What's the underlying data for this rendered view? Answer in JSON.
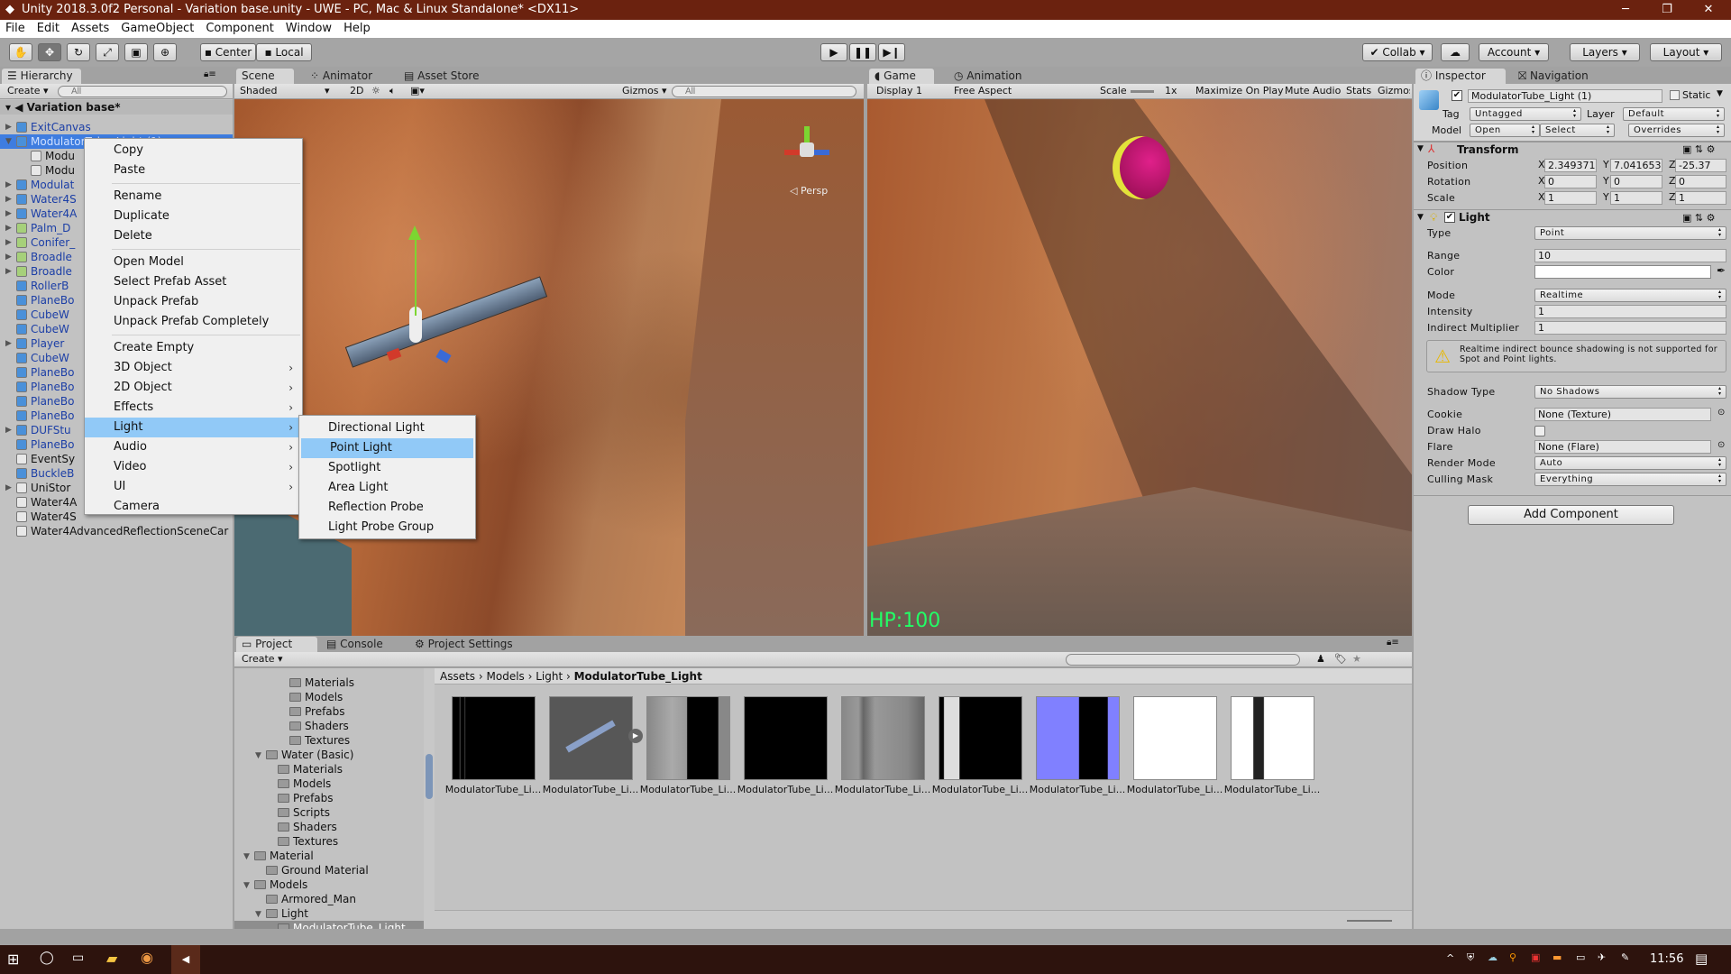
{
  "window": {
    "title": "Unity 2018.3.0f2 Personal - Variation base.unity - UWE - PC, Mac & Linux Standalone* <DX11>",
    "minimize": "─",
    "maximize": "❐",
    "close": "✕"
  },
  "menu": [
    "File",
    "Edit",
    "Assets",
    "GameObject",
    "Component",
    "Window",
    "Help"
  ],
  "toolbar": {
    "center": "Center",
    "local": "Local",
    "collab": "Collab ▾",
    "account": "Account",
    "layers": "Layers",
    "layout": "Layout",
    "tools": [
      "hand-tool",
      "move-tool",
      "rotate-tool",
      "scale-tool",
      "rect-tool",
      "transform-tool"
    ]
  },
  "hierarchy": {
    "tab": "Hierarchy",
    "create": "Create",
    "search_placeholder": "All",
    "scene": "Variation base*",
    "items": [
      {
        "label": "ExitCanvas",
        "kind": "prefab",
        "arrow": "right",
        "depth": 0
      },
      {
        "label": "ModulatorTube_Light (1)",
        "kind": "prefab",
        "arrow": "down",
        "depth": 0,
        "selected": true
      },
      {
        "label": "Modu",
        "kind": "object",
        "depth": 1
      },
      {
        "label": "Modu",
        "kind": "object",
        "depth": 1
      },
      {
        "label": "Modulat",
        "kind": "prefab",
        "arrow": "right",
        "depth": 0
      },
      {
        "label": "Water4S",
        "kind": "prefab",
        "arrow": "right",
        "depth": 0
      },
      {
        "label": "Water4A",
        "kind": "prefab",
        "arrow": "right",
        "depth": 0
      },
      {
        "label": "Palm_D",
        "kind": "tree",
        "arrow": "right",
        "depth": 0
      },
      {
        "label": "Conifer_",
        "kind": "tree",
        "arrow": "right",
        "depth": 0
      },
      {
        "label": "Broadle",
        "kind": "tree",
        "arrow": "right",
        "depth": 0
      },
      {
        "label": "Broadle",
        "kind": "tree",
        "arrow": "right",
        "depth": 0
      },
      {
        "label": "RollerB",
        "kind": "prefab",
        "depth": 0
      },
      {
        "label": "PlaneBo",
        "kind": "prefab",
        "depth": 0
      },
      {
        "label": "CubeW",
        "kind": "prefab",
        "depth": 0
      },
      {
        "label": "CubeW",
        "kind": "prefab",
        "depth": 0
      },
      {
        "label": "Player",
        "kind": "prefab",
        "arrow": "right",
        "depth": 0
      },
      {
        "label": "CubeW",
        "kind": "prefab",
        "depth": 0
      },
      {
        "label": "PlaneBo",
        "kind": "prefab",
        "depth": 0
      },
      {
        "label": "PlaneBo",
        "kind": "prefab",
        "depth": 0
      },
      {
        "label": "PlaneBo",
        "kind": "prefab",
        "depth": 0
      },
      {
        "label": "PlaneBo",
        "kind": "prefab",
        "depth": 0
      },
      {
        "label": "DUFStu",
        "kind": "prefab",
        "arrow": "right",
        "depth": 0
      },
      {
        "label": "PlaneBo",
        "kind": "prefab",
        "depth": 0
      },
      {
        "label": "EventSy",
        "kind": "object",
        "depth": 0
      },
      {
        "label": "BuckleB",
        "kind": "prefab",
        "depth": 0
      },
      {
        "label": "UniStor",
        "kind": "object",
        "arrow": "right",
        "depth": 0
      },
      {
        "label": "Water4A",
        "kind": "object",
        "depth": 0
      },
      {
        "label": "Water4S",
        "kind": "object",
        "depth": 0
      },
      {
        "label": "Water4AdvancedReflectionSceneCar",
        "kind": "object",
        "depth": 0
      }
    ]
  },
  "context_menu": {
    "groups": [
      [
        "Copy",
        "Paste"
      ],
      [
        "Rename",
        "Duplicate",
        "Delete"
      ],
      [
        "Open Model",
        "Select Prefab Asset",
        "Unpack Prefab",
        "Unpack Prefab Completely"
      ],
      [
        "Create Empty",
        "3D Object",
        "2D Object",
        "Effects",
        "Light",
        "Audio",
        "Video",
        "UI",
        "Camera"
      ]
    ],
    "submenu_items": [
      "3D Object",
      "2D Object",
      "Effects",
      "Light",
      "Audio",
      "Video",
      "UI"
    ],
    "highlighted": "Light"
  },
  "light_submenu": {
    "items": [
      "Directional Light",
      "Point Light",
      "Spotlight",
      "Area Light",
      "Reflection Probe",
      "Light Probe Group"
    ],
    "highlighted": "Point Light"
  },
  "scene": {
    "tabs": [
      "Scene",
      "Animator",
      "Asset Store"
    ],
    "shading": "Shaded",
    "mode_2d": "2D",
    "gizmos": "Gizmos",
    "search_placeholder": "All",
    "persp": "Persp"
  },
  "game": {
    "tabs": [
      "Game",
      "Animation"
    ],
    "display": "Display 1",
    "aspect": "Free Aspect",
    "scale_label": "Scale",
    "scale_value": "1x",
    "buttons": [
      "Maximize On Play",
      "Mute Audio",
      "Stats",
      "Gizmos"
    ],
    "hud": "HP:100",
    "hud_color": "#22ff66"
  },
  "inspector": {
    "tabs": [
      "Inspector",
      "Navigation"
    ],
    "object_name": "ModulatorTube_Light (1)",
    "active": true,
    "static_label": "Static",
    "static": false,
    "tag_label": "Tag",
    "tag": "Untagged",
    "layer_label": "Layer",
    "layer": "Default",
    "model_label": "Model",
    "open": "Open",
    "select": "Select",
    "overrides": "Overrides",
    "transform": {
      "title": "Transform",
      "rows": [
        {
          "label": "Position",
          "x": "2.349371",
          "y": "7.041653",
          "z": "-25.37"
        },
        {
          "label": "Rotation",
          "x": "0",
          "y": "0",
          "z": "0"
        },
        {
          "label": "Scale",
          "x": "1",
          "y": "1",
          "z": "1"
        }
      ]
    },
    "light": {
      "title": "Light",
      "enabled": true,
      "type_label": "Type",
      "type": "Point",
      "range_label": "Range",
      "range": "10",
      "color_label": "Color",
      "color": "#ffffff",
      "mode_label": "Mode",
      "mode": "Realtime",
      "intensity_label": "Intensity",
      "intensity": "1",
      "indirect_label": "Indirect Multiplier",
      "indirect": "1",
      "warning": "Realtime indirect bounce shadowing is not supported for Spot and Point lights.",
      "shadow_label": "Shadow Type",
      "shadow": "No Shadows",
      "cookie_label": "Cookie",
      "cookie": "None (Texture)",
      "halo_label": "Draw Halo",
      "halo": false,
      "flare_label": "Flare",
      "flare": "None (Flare)",
      "render_label": "Render Mode",
      "render": "Auto",
      "culling_label": "Culling Mask",
      "culling": "Everything"
    },
    "add_component": "Add Component"
  },
  "project": {
    "tabs": [
      "Project",
      "Console",
      "Project Settings"
    ],
    "create": "Create",
    "tree": [
      {
        "label": "Materials",
        "depth": 3
      },
      {
        "label": "Models",
        "depth": 3
      },
      {
        "label": "Prefabs",
        "depth": 3
      },
      {
        "label": "Shaders",
        "depth": 3
      },
      {
        "label": "Textures",
        "depth": 3
      },
      {
        "label": "Water (Basic)",
        "depth": 1,
        "arrow": true
      },
      {
        "label": "Materials",
        "depth": 2
      },
      {
        "label": "Models",
        "depth": 2
      },
      {
        "label": "Prefabs",
        "depth": 2
      },
      {
        "label": "Scripts",
        "depth": 2
      },
      {
        "label": "Shaders",
        "depth": 2
      },
      {
        "label": "Textures",
        "depth": 2
      },
      {
        "label": "Material",
        "depth": 0,
        "arrow": true
      },
      {
        "label": "Ground Material",
        "depth": 1
      },
      {
        "label": "Models",
        "depth": 0,
        "arrow": true
      },
      {
        "label": "Armored_Man",
        "depth": 1
      },
      {
        "label": "Light",
        "depth": 1,
        "arrow": true
      },
      {
        "label": "ModulatorTube_Light",
        "depth": 2,
        "selected": true
      }
    ],
    "breadcrumb": [
      "Assets",
      "Models",
      "Light",
      "ModulatorTube_Light"
    ],
    "assets": [
      "ModulatorTube_Li...",
      "ModulatorTube_Li...",
      "ModulatorTube_Li...",
      "ModulatorTube_Li...",
      "ModulatorTube_Li...",
      "ModulatorTube_Li...",
      "ModulatorTube_Li...",
      "ModulatorTube_Li...",
      "ModulatorTube_Li..."
    ]
  },
  "taskbar": {
    "time": "11:56"
  }
}
